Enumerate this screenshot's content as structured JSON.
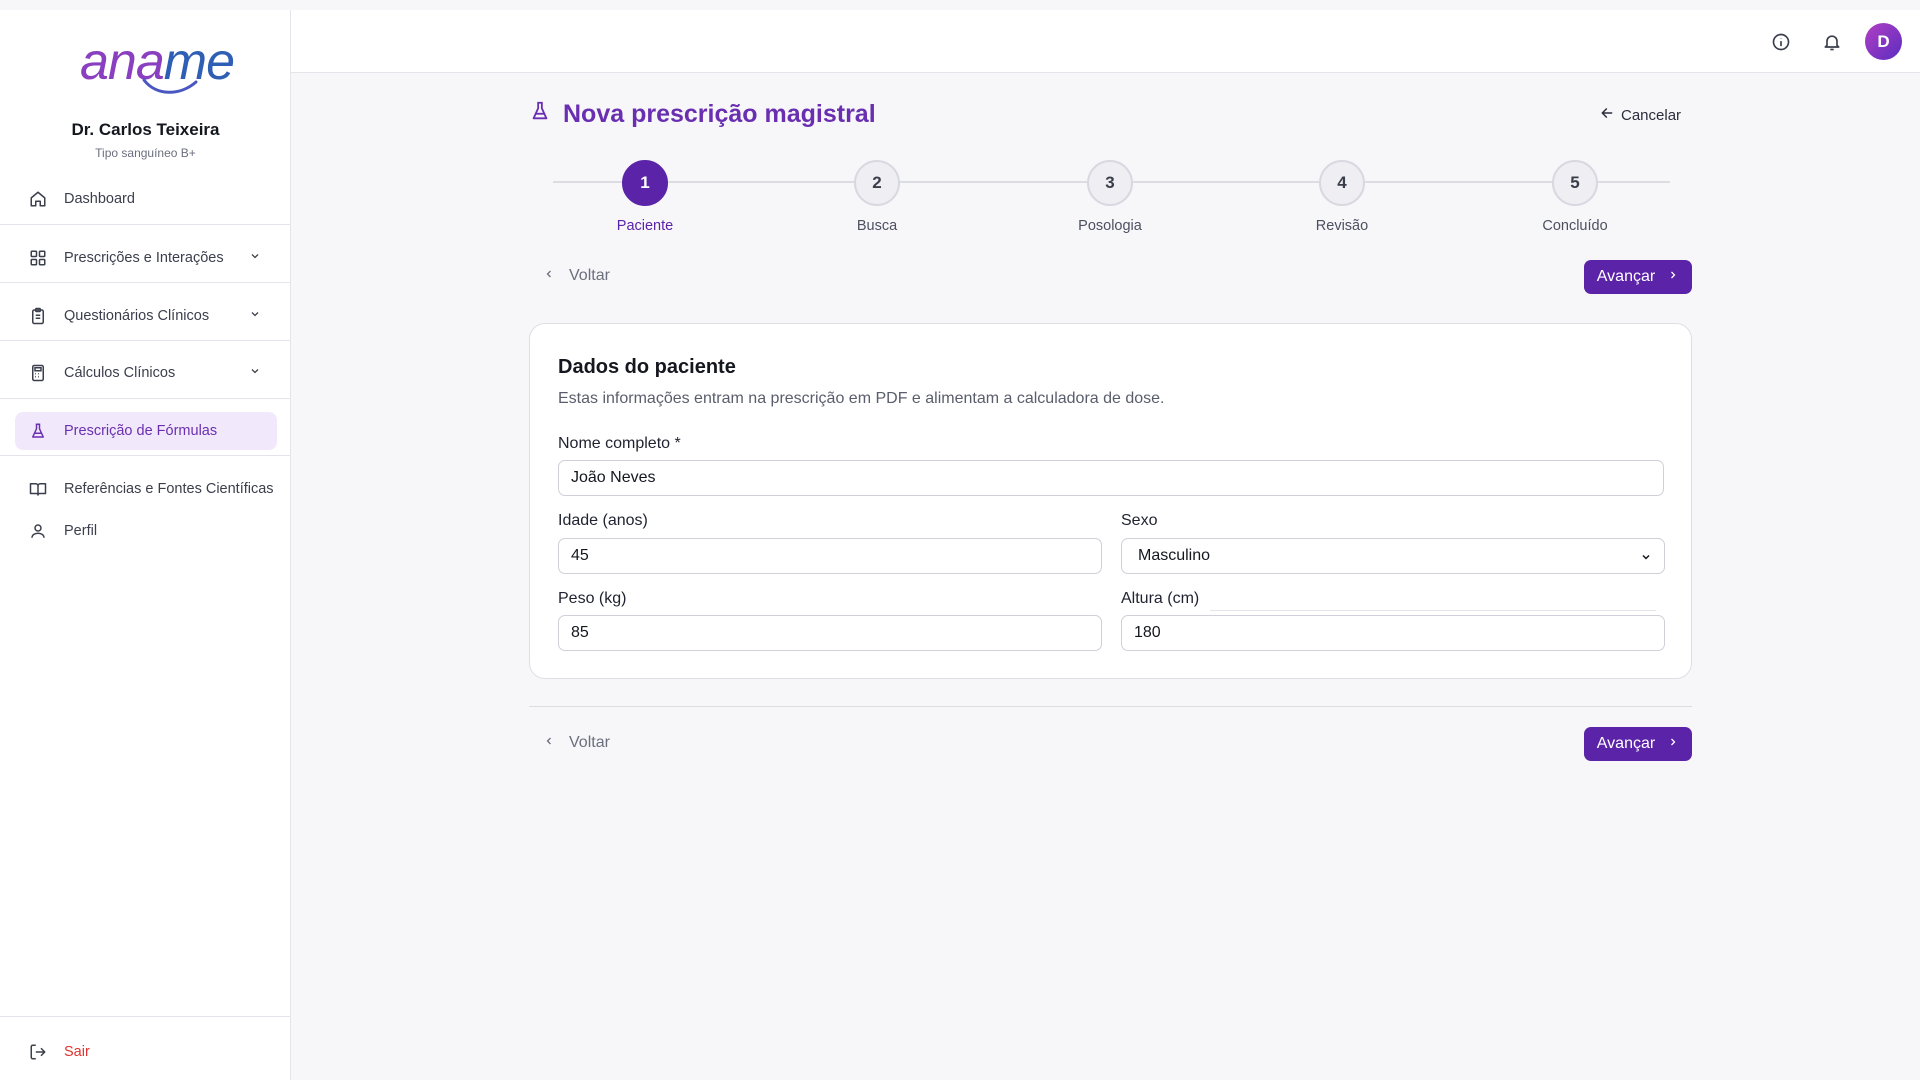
{
  "app": {
    "logo_part1": "ana",
    "logo_part2": "me",
    "brand_color": "#6a2fb0",
    "accent_color": "#5b24a8"
  },
  "user": {
    "name": "Dr. Carlos Teixeira",
    "subtitle": "Tipo sanguíneo B+",
    "avatar_initial": "D"
  },
  "sidebar": {
    "items": [
      {
        "label": "Dashboard",
        "icon": "home-icon"
      },
      {
        "label": "Prescrições e Interações",
        "icon": "grid-icon",
        "expandable": true
      },
      {
        "label": "Questionários Clínicos",
        "icon": "clipboard-icon",
        "expandable": true
      },
      {
        "label": "Cálculos Clínicos",
        "icon": "calculator-icon",
        "expandable": true
      },
      {
        "label": "Prescrição de Fórmulas",
        "icon": "flask-icon",
        "active": true
      },
      {
        "label": "Referências e Fontes Científicas",
        "icon": "book-icon"
      },
      {
        "label": "Perfil",
        "icon": "user-icon"
      }
    ],
    "logout_label": "Sair"
  },
  "header": {
    "icons": [
      "info-icon",
      "bell-icon"
    ]
  },
  "main": {
    "title": "Nova prescrição magistral",
    "cancel_label": "Cancelar",
    "steps": [
      {
        "number": "1",
        "label": "Paciente",
        "active": true
      },
      {
        "number": "2",
        "label": "Busca"
      },
      {
        "number": "3",
        "label": "Posologia"
      },
      {
        "number": "4",
        "label": "Revisão"
      },
      {
        "number": "5",
        "label": "Concluído"
      }
    ],
    "back_label": "Voltar",
    "next_label": "Avançar"
  },
  "form": {
    "title": "Dados do paciente",
    "description": "Estas informações entram na prescrição em PDF e alimentam a calculadora de dose.",
    "name_label": "Nome completo *",
    "name_value": "João Neves",
    "age_label": "Idade (anos)",
    "age_value": "45",
    "sex_label": "Sexo",
    "sex_value": "Masculino",
    "weight_label": "Peso (kg)",
    "weight_value": "85",
    "height_label": "Altura (cm)",
    "height_value": "180"
  }
}
